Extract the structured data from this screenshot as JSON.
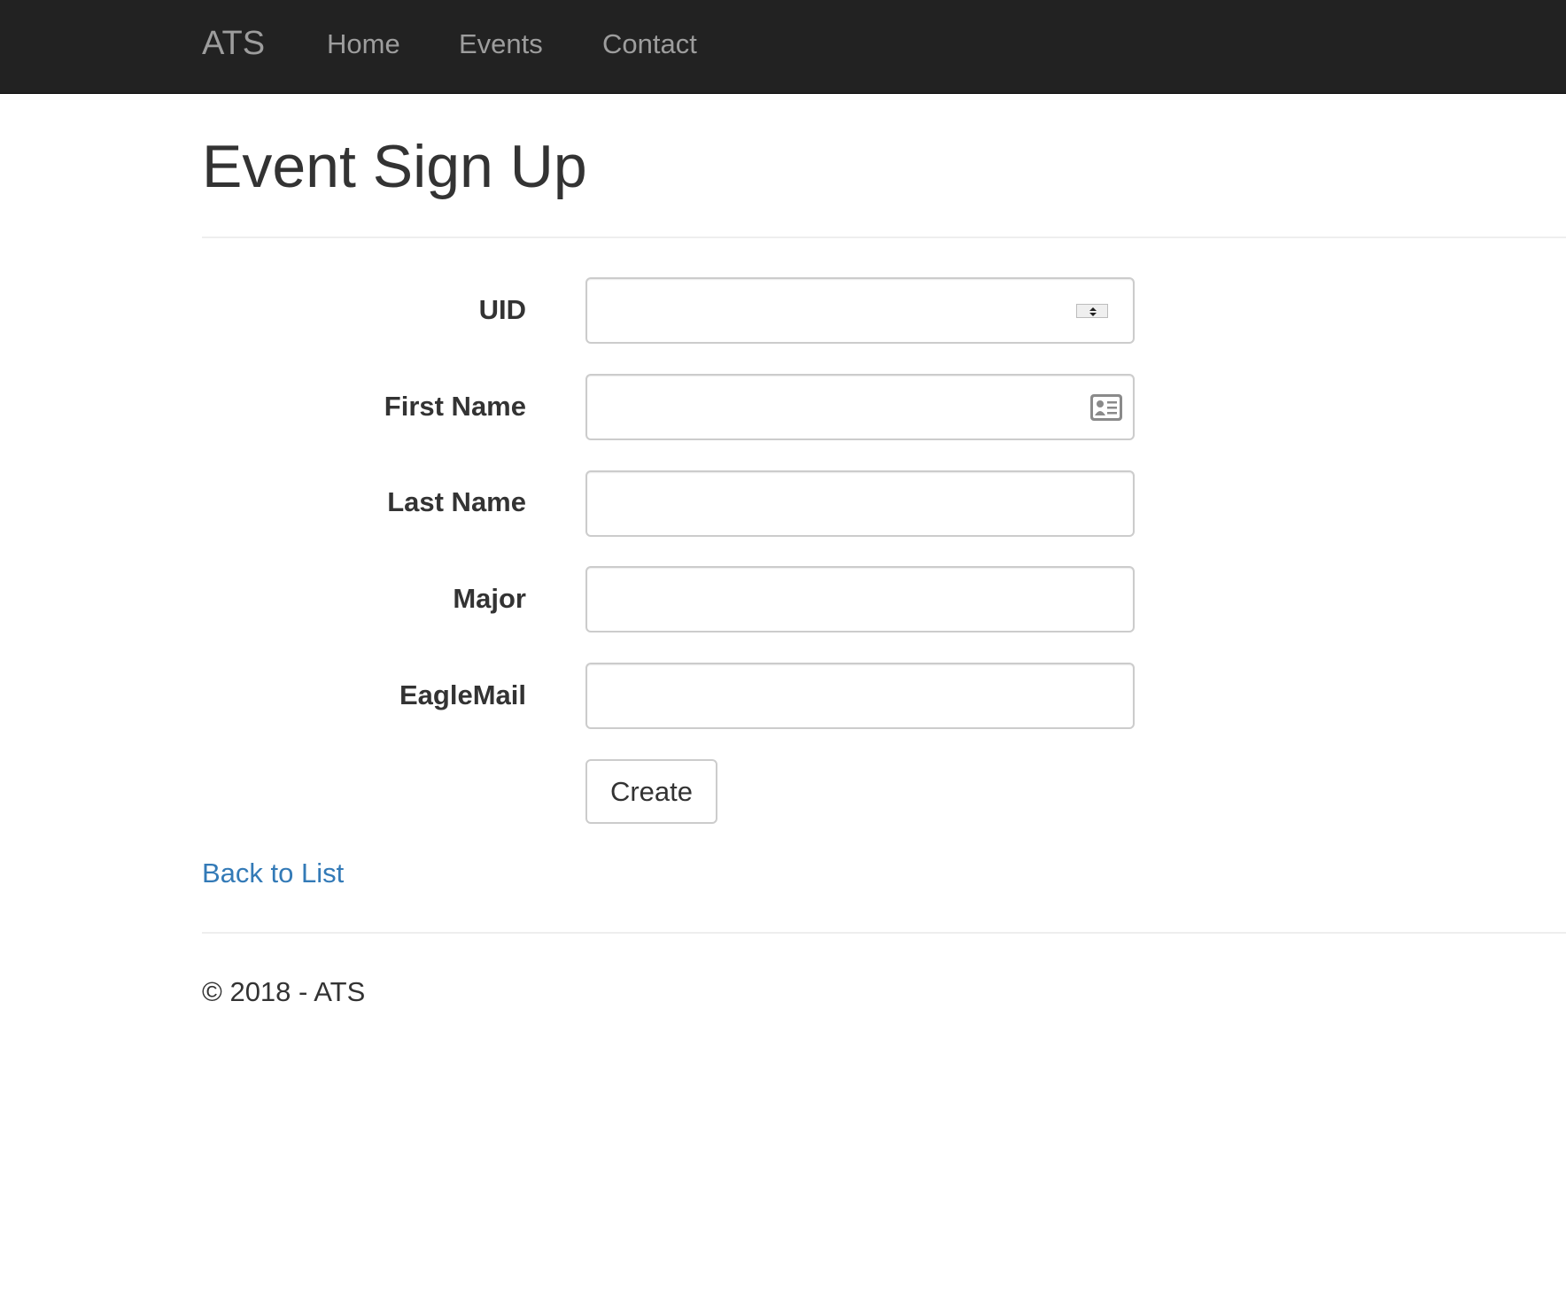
{
  "navbar": {
    "brand": "ATS",
    "links": [
      {
        "label": "Home"
      },
      {
        "label": "Events"
      },
      {
        "label": "Contact"
      }
    ]
  },
  "page": {
    "title": "Event Sign Up"
  },
  "form": {
    "fields": [
      {
        "label": "UID",
        "value": "",
        "icon": "number-spinner-icon"
      },
      {
        "label": "First Name",
        "value": "",
        "icon": "contact-card-icon"
      },
      {
        "label": "Last Name",
        "value": ""
      },
      {
        "label": "Major",
        "value": ""
      },
      {
        "label": "EagleMail",
        "value": ""
      }
    ],
    "submit_label": "Create"
  },
  "back_link": "Back to List",
  "footer": {
    "text": "© 2018 - ATS"
  },
  "colors": {
    "navbar_bg": "#222222",
    "nav_text": "#9d9d9d",
    "link": "#337ab7",
    "text": "#333333"
  }
}
